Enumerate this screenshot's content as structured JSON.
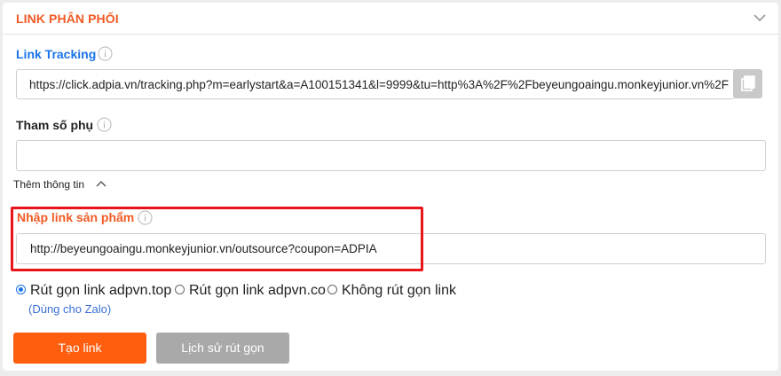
{
  "section": {
    "title": "LINK PHÂN PHỐI"
  },
  "tracking": {
    "label": "Link Tracking",
    "value": "https://click.adpia.vn/tracking.php?m=earlystart&a=A100151341&l=9999&tu=http%3A%2F%2Fbeyeungoaingu.monkeyjunior.vn%2F"
  },
  "extra_param": {
    "label": "Tham số phụ",
    "value": ""
  },
  "more_info": {
    "label": "Thêm thông tin"
  },
  "product_link": {
    "label": "Nhập link sản phẩm",
    "value": "http://beyeungoaingu.monkeyjunior.vn/outsource?coupon=ADPIA"
  },
  "shorten_options": [
    {
      "label": "Rút gọn link adpvn.top",
      "selected": true
    },
    {
      "label": "Rút gọn link adpvn.co",
      "selected": false
    },
    {
      "label": "Không rút gọn link",
      "selected": false
    }
  ],
  "shorten_note": "(Dùng cho Zalo)",
  "actions": {
    "create_label": "Tạo link",
    "history_label": "Lịch sử rút gọn"
  },
  "colors": {
    "accent": "#f15a24",
    "link_blue": "#1a73e8",
    "highlight": "#e8141c",
    "primary_button": "#ff5e0e",
    "secondary_button": "#a9a9a9"
  }
}
